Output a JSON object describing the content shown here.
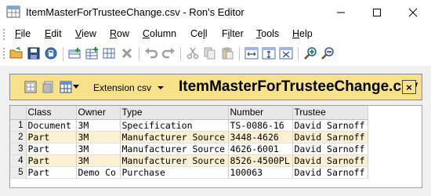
{
  "window": {
    "title": "ItemMasterForTrusteeChange.csv - Ron's Editor"
  },
  "menu": {
    "items": [
      {
        "accel": "F",
        "rest": "ile"
      },
      {
        "accel": "E",
        "rest": "dit"
      },
      {
        "accel": "V",
        "rest": "iew"
      },
      {
        "accel": "R",
        "rest": "ow"
      },
      {
        "accel": "C",
        "rest": "olumn"
      },
      {
        "pre": "Ce",
        "accel": "l",
        "rest": "l"
      },
      {
        "pre": "F",
        "accel": "i",
        "rest": "lter"
      },
      {
        "accel": "T",
        "rest": "ools"
      },
      {
        "accel": "H",
        "rest": "elp"
      }
    ]
  },
  "panel": {
    "extension_label": "Extension csv",
    "file_name": "ItemMasterForTrusteeChange.csv",
    "close_label": "×"
  },
  "grid": {
    "columns": [
      "Class",
      "Owner",
      "Type",
      "Number",
      "Trustee"
    ],
    "rows": [
      {
        "num": "1",
        "cells": [
          "Document",
          "3M",
          "Specification",
          "TS-0086-16",
          "David Sarnoff"
        ]
      },
      {
        "num": "2",
        "cells": [
          "Part",
          "3M",
          "Manufacturer Source",
          "3448-4626",
          "David Sarnoff"
        ]
      },
      {
        "num": "3",
        "cells": [
          "Part",
          "3M",
          "Manufacturer Source",
          "4626-6001",
          "David Sarnoff"
        ]
      },
      {
        "num": "4",
        "cells": [
          "Part",
          "3M",
          "Manufacturer Source",
          "8526-4500PL",
          "David Sarnoff"
        ]
      },
      {
        "num": "5",
        "cells": [
          "Part",
          "Demo Co",
          "Purchase",
          "100063",
          "David Sarnoff"
        ]
      }
    ]
  },
  "colors": {
    "panel_header_bg": "#f7e18a",
    "alt_row_bg": "#fbf1d2",
    "doc_area_bg": "#f0f0f0"
  },
  "icons": {
    "toolbar": [
      "open-folder-icon",
      "save-icon",
      "save-all-icon",
      "add-row-icon",
      "insert-row-icon",
      "add-column-icon",
      "delete-icon",
      "undo-icon",
      "redo-icon",
      "cut-icon",
      "copy-icon",
      "paste-icon",
      "fit-width-icon",
      "fit-height-icon",
      "fit-all-icon",
      "zoom-in-icon",
      "zoom-out-icon"
    ]
  }
}
